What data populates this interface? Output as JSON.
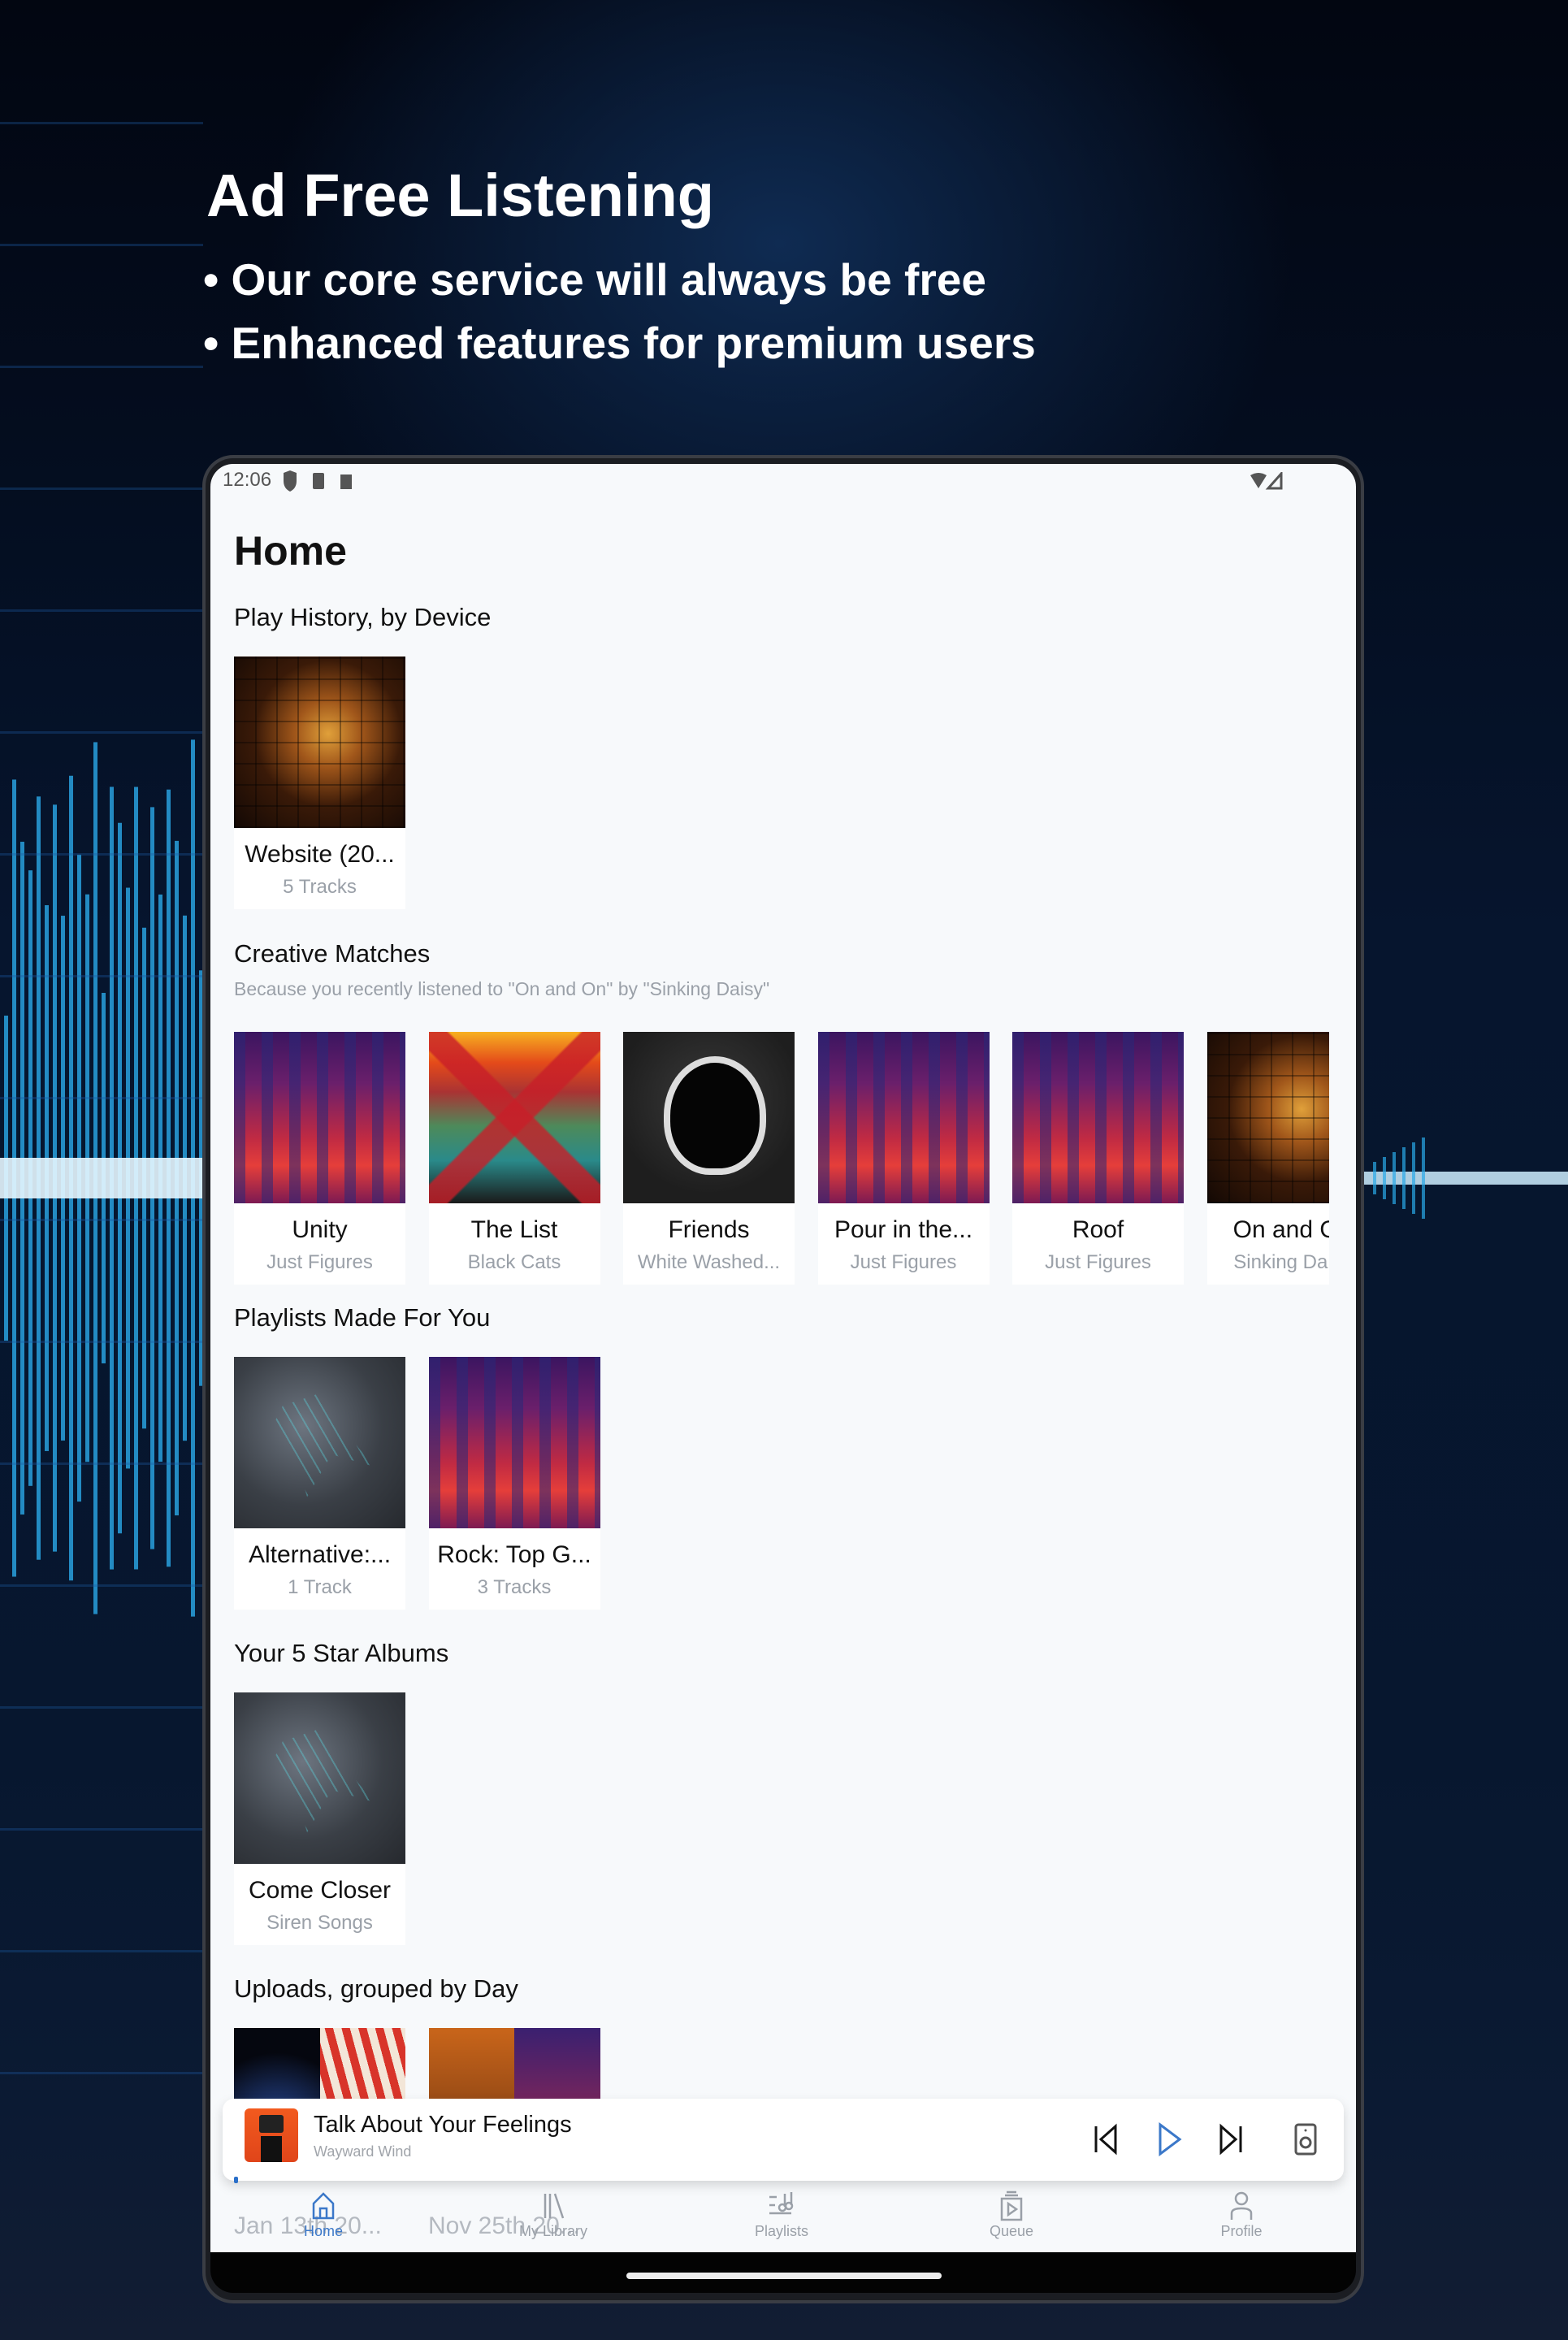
{
  "promo": {
    "title": "Ad Free Listening",
    "bullets": [
      "• Our core service will always be free",
      "• Enhanced features for premium users"
    ]
  },
  "status_bar": {
    "time": "12:06",
    "icons": [
      "play-protect-icon",
      "sd-card-icon",
      "a-notification-icon",
      "wifi-icon",
      "signal-icon"
    ]
  },
  "page": {
    "title": "Home"
  },
  "sections": [
    {
      "title": "Play History, by Device",
      "subtitle": "",
      "items": [
        {
          "title": "Website (20...",
          "subtitle": "5 Tracks",
          "art": "face"
        }
      ]
    },
    {
      "title": "Creative Matches",
      "subtitle": "Because you recently listened to \"On and On\" by \"Sinking Daisy\"",
      "items": [
        {
          "title": "Unity",
          "subtitle": "Just Figures",
          "art": "city"
        },
        {
          "title": "The List",
          "subtitle": "Black Cats",
          "art": "xlist"
        },
        {
          "title": "Friends",
          "subtitle": "White Washed...",
          "art": "astro"
        },
        {
          "title": "Pour in the...",
          "subtitle": "Just Figures",
          "art": "city"
        },
        {
          "title": "Roof",
          "subtitle": "Just Figures",
          "art": "city"
        },
        {
          "title": "On and On",
          "subtitle": "Sinking Daisy",
          "art": "face"
        }
      ]
    },
    {
      "title": "Playlists Made For You",
      "subtitle": "",
      "items": [
        {
          "title": "Alternative:...",
          "subtitle": "1 Track",
          "art": "runner"
        },
        {
          "title": "Rock: Top G...",
          "subtitle": "3 Tracks",
          "art": "city"
        }
      ]
    },
    {
      "title": "Your 5 Star Albums",
      "subtitle": "",
      "items": [
        {
          "title": "Come Closer",
          "subtitle": "Siren Songs",
          "art": "runner"
        }
      ]
    },
    {
      "title": "Uploads, grouped by Day",
      "subtitle": "",
      "items": [
        {
          "title": "Jan 13th 20...",
          "subtitle": "",
          "art": "split-blue-stripes"
        },
        {
          "title": "Nov 25th 20...",
          "subtitle": "",
          "art": "split-orange-city"
        }
      ]
    }
  ],
  "mini_player": {
    "title": "Talk About Your Feelings",
    "artist": "Wayward Wind",
    "progress": 0.0,
    "accent": "#3b78c9"
  },
  "nav": [
    {
      "label": "Home",
      "icon": "home-icon",
      "active": true
    },
    {
      "label": "My Library",
      "icon": "library-icon",
      "active": false
    },
    {
      "label": "Playlists",
      "icon": "playlists-icon",
      "active": false
    },
    {
      "label": "Queue",
      "icon": "queue-icon",
      "active": false
    },
    {
      "label": "Profile",
      "icon": "profile-icon",
      "active": false
    }
  ]
}
